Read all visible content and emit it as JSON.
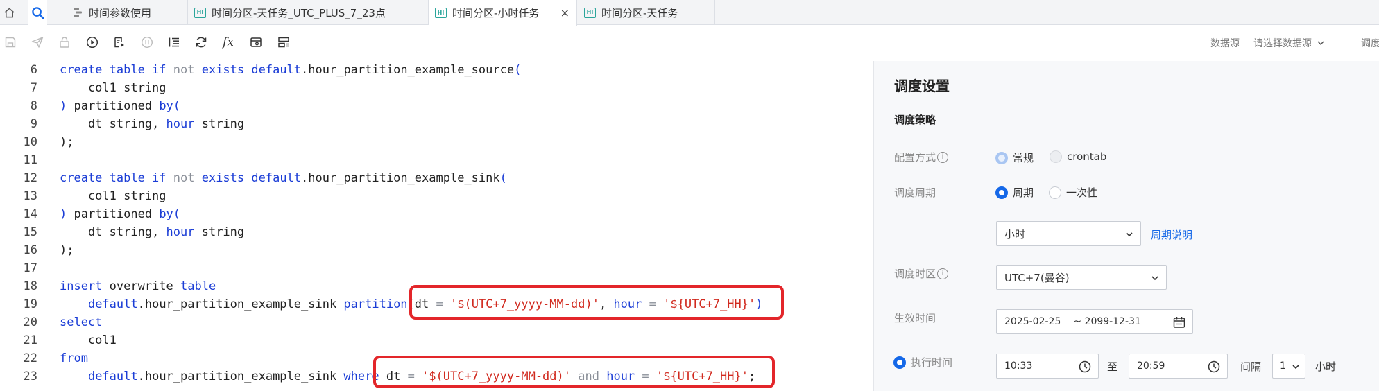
{
  "tabs": [
    {
      "label": "时间参数使用",
      "icon": "flow-icon",
      "active": false
    },
    {
      "label": "时间分区-天任务_UTC_PLUS_7_23点",
      "icon": "hive-icon",
      "active": false
    },
    {
      "label": "时间分区-小时任务",
      "icon": "hive-icon",
      "active": true,
      "close": "×"
    },
    {
      "label": "时间分区-天任务",
      "icon": "hive-icon",
      "active": false
    }
  ],
  "hive_badge": "HI",
  "toolbar": {
    "fx_label": "fx",
    "datasource_label": "数据源",
    "datasource_select": "请选择数据源",
    "cut_label": "调度"
  },
  "editor": {
    "lines": [
      {
        "n": "6",
        "t": [
          [
            "kw",
            "create table if "
          ],
          [
            "nt",
            "not"
          ],
          [
            "kw",
            " exists "
          ],
          [
            "kw",
            "default"
          ],
          [
            "p",
            ".hour_partition_example_source"
          ],
          [
            "kw",
            "("
          ]
        ]
      },
      {
        "n": "7",
        "t": [
          [
            "p",
            "    col1 string"
          ]
        ]
      },
      {
        "n": "8",
        "t": [
          [
            "kw",
            ")"
          ],
          [
            "p",
            " partitioned "
          ],
          [
            "kw",
            "by("
          ]
        ]
      },
      {
        "n": "9",
        "t": [
          [
            "p",
            "    dt string, "
          ],
          [
            "kw",
            "hour"
          ],
          [
            "p",
            " string"
          ]
        ]
      },
      {
        "n": "10",
        "t": [
          [
            "p",
            ");"
          ]
        ]
      },
      {
        "n": "11",
        "t": []
      },
      {
        "n": "12",
        "t": [
          [
            "kw",
            "create table if "
          ],
          [
            "nt",
            "not"
          ],
          [
            "kw",
            " exists "
          ],
          [
            "kw",
            "default"
          ],
          [
            "p",
            ".hour_partition_example_sink"
          ],
          [
            "kw",
            "("
          ]
        ]
      },
      {
        "n": "13",
        "t": [
          [
            "p",
            "    col1 string"
          ]
        ]
      },
      {
        "n": "14",
        "t": [
          [
            "kw",
            ")"
          ],
          [
            "p",
            " partitioned "
          ],
          [
            "kw",
            "by("
          ]
        ]
      },
      {
        "n": "15",
        "t": [
          [
            "p",
            "    dt string, "
          ],
          [
            "kw",
            "hour"
          ],
          [
            "p",
            " string"
          ]
        ]
      },
      {
        "n": "16",
        "t": [
          [
            "p",
            ");"
          ]
        ]
      },
      {
        "n": "17",
        "t": []
      },
      {
        "n": "18",
        "t": [
          [
            "kw",
            "insert"
          ],
          [
            "p",
            " overwrite "
          ],
          [
            "kw",
            "table"
          ]
        ]
      },
      {
        "n": "19",
        "t": [
          [
            "p",
            "    "
          ],
          [
            "kw",
            "default"
          ],
          [
            "p",
            ".hour_partition_example_sink "
          ],
          [
            "kw",
            "partition"
          ],
          [
            "p",
            "(dt "
          ],
          [
            "nt",
            "="
          ],
          [
            "p",
            " "
          ],
          [
            "str",
            "'$(UTC+7_yyyy-MM-dd)'"
          ],
          [
            "p",
            ", "
          ],
          [
            "kw",
            "hour"
          ],
          [
            "p",
            " "
          ],
          [
            "nt",
            "="
          ],
          [
            "p",
            " "
          ],
          [
            "str",
            "'${UTC+7_HH}'"
          ],
          [
            "kw",
            ")"
          ]
        ]
      },
      {
        "n": "20",
        "t": [
          [
            "kw",
            "select"
          ]
        ]
      },
      {
        "n": "21",
        "t": [
          [
            "p",
            "    col1"
          ]
        ]
      },
      {
        "n": "22",
        "t": [
          [
            "kw",
            "from"
          ]
        ]
      },
      {
        "n": "23",
        "t": [
          [
            "p",
            "    "
          ],
          [
            "kw",
            "default"
          ],
          [
            "p",
            ".hour_partition_example_sink "
          ],
          [
            "kw",
            "where"
          ],
          [
            "p",
            " dt "
          ],
          [
            "nt",
            "="
          ],
          [
            "p",
            " "
          ],
          [
            "str",
            "'$(UTC+7_yyyy-MM-dd)'"
          ],
          [
            "p",
            " "
          ],
          [
            "nt",
            "and"
          ],
          [
            "p",
            " "
          ],
          [
            "kw",
            "hour"
          ],
          [
            "p",
            " "
          ],
          [
            "nt",
            "="
          ],
          [
            "p",
            " "
          ],
          [
            "str",
            "'${UTC+7_HH}'"
          ],
          [
            "p",
            ";"
          ]
        ]
      }
    ]
  },
  "panel": {
    "title": "调度设置",
    "section": "调度策略",
    "config_label": "配置方式",
    "config_options": [
      "常规",
      "crontab"
    ],
    "period_label": "调度周期",
    "period_options": [
      "周期",
      "一次性"
    ],
    "cycle_value": "小时",
    "cycle_link": "周期说明",
    "timezone_label": "调度时区",
    "timezone_value": "UTC+7(曼谷)",
    "effective_label": "生效时间",
    "effective_start": "2025-02-25",
    "effective_end": "~ 2099-12-31",
    "exec_label": "执行时间",
    "exec_start": "10:33",
    "exec_to": "至",
    "exec_end": "20:59",
    "interval_label": "间隔",
    "interval_value": "1",
    "interval_unit": "小时"
  },
  "colors": {
    "accent": "#1568e8",
    "keyword": "#1b3dd6",
    "string": "#d12a1f",
    "highlight": "#e3262a"
  }
}
